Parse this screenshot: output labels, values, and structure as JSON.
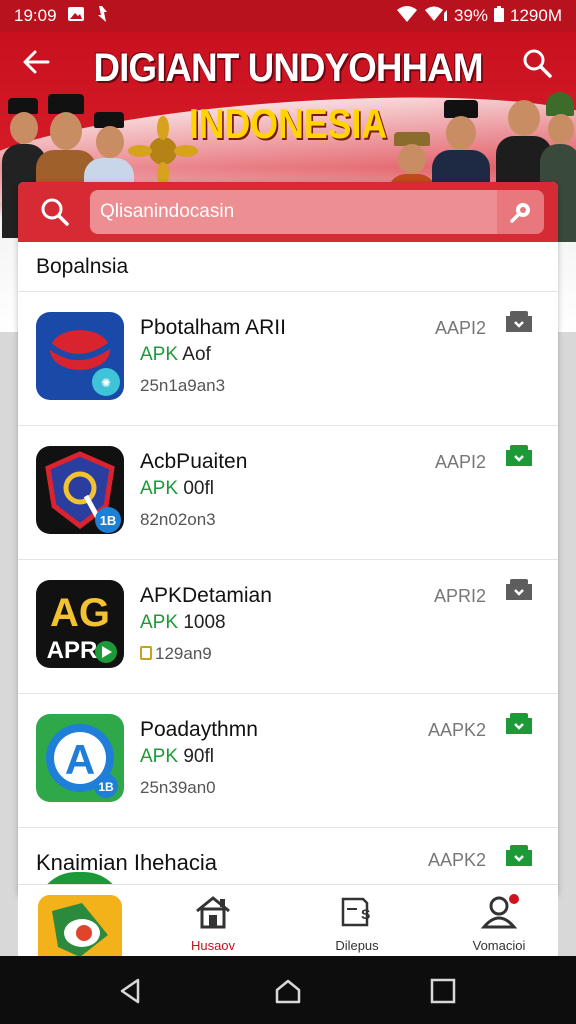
{
  "status_bar": {
    "time": "19:09",
    "battery": "39%",
    "clock_right": "1290M"
  },
  "header": {
    "title": "DIGIANT UNDYOHHAM",
    "subtitle": "INDONESIA"
  },
  "search": {
    "placeholder": "Qlisanindocasin"
  },
  "section": {
    "title": "Bopalnsia"
  },
  "apps": [
    {
      "name": "Pbotalham ARII",
      "apk": "APK",
      "type_rest": "Aof",
      "date": "25n1a9an3",
      "version": "AAPI2",
      "download_color": "#5e5e5e"
    },
    {
      "name": "AcbPuaiten",
      "apk": "APK",
      "type_rest": "00fl",
      "date": "82n02on3",
      "version": "AAPI2",
      "download_color": "#1d9a38"
    },
    {
      "name": "APKDetamian",
      "apk": "APK",
      "type_rest": "1008",
      "date": "129an9",
      "version": "APRI2",
      "download_color": "#5e5e5e"
    },
    {
      "name": "Poadaythmn",
      "apk": "APK",
      "type_rest": "90fl",
      "date": "25n39an0",
      "version": "AAPK2",
      "download_color": "#1d9a38"
    }
  ],
  "partial_row": {
    "name": "Knaimian Ihehacia",
    "version": "AAPK2"
  },
  "bottom_nav": {
    "items": [
      {
        "label": "Husaov",
        "icon": "home-icon"
      },
      {
        "label": "Dilepus",
        "icon": "downloads-icon"
      },
      {
        "label": "Vomacioi",
        "icon": "profile-icon"
      }
    ]
  },
  "colors": {
    "brand_red": "#c8101f",
    "apk_green": "#1d9a38"
  }
}
